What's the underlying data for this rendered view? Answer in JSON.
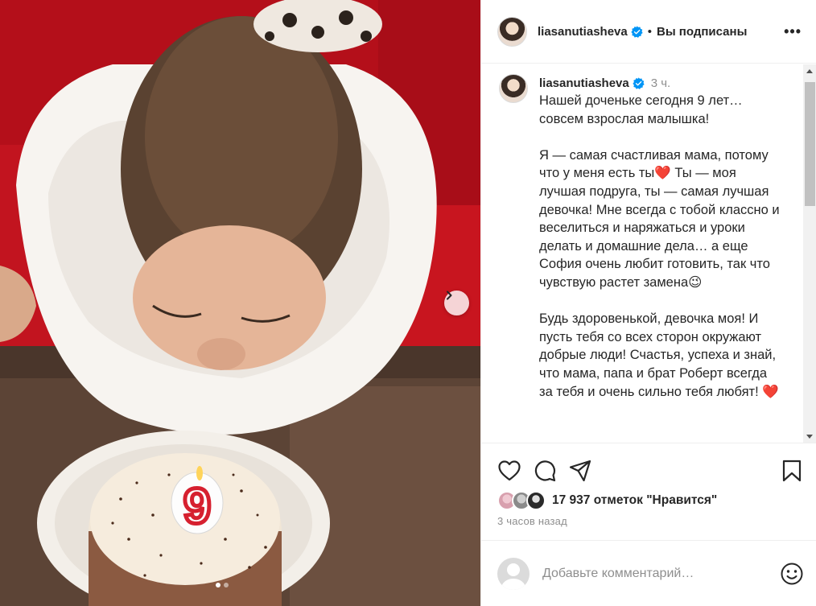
{
  "post": {
    "username": "liasanutiasheva",
    "follow_separator": "•",
    "follow_status": "Вы подписаны",
    "more_label": "•••"
  },
  "caption": {
    "username": "liasanutiasheva",
    "time": "3 ч.",
    "text": "Нашей доченьке сегодня 9 лет… совсем взрослая малышка!\n\nЯ — самая счастливая мама, потому что у меня есть ты❤️ Ты — моя лучшая подруга, ты — самая лучшая девочка! Мне всегда с тобой классно и веселиться и наряжаться и уроки делать и домашние дела… а еще София очень любит готовить, так что чувствую растет замена😉\n\nБудь здоровенькой, девочка моя! И пусть тебя со всех сторон окружают добрые люди! Счастья, успеха и знай, что мама, папа и брат Роберт всегда за тебя и очень сильно тебя любят! ❤️"
  },
  "likes": {
    "text": "17 937 отметок \"Нравится\""
  },
  "post_time": "3 часов назад",
  "comment": {
    "placeholder": "Добавьте комментарий…"
  },
  "carousel": {
    "slide_count": 2,
    "active_index": 0
  },
  "colors": {
    "verified": "#0095f6",
    "heart": "#ed4956",
    "text": "#262626",
    "muted": "#8e8e8e"
  },
  "icons": [
    "heart-icon",
    "comment-icon",
    "share-icon",
    "bookmark-icon",
    "emoji-icon",
    "verified-badge-icon",
    "chevron-right-icon"
  ]
}
